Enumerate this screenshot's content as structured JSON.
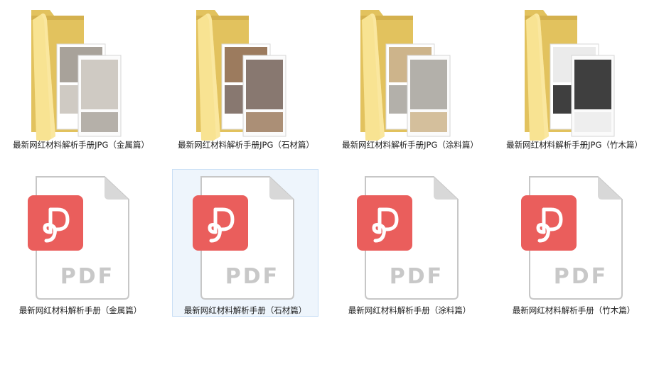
{
  "colors": {
    "folder_back": "#e2c25e",
    "folder_front": "#f8e392",
    "pdf_badge": "#ea5e5c",
    "pdf_text": "#c8c8c8",
    "selection_bg": "#eef5fc",
    "selection_border": "#c9dff5"
  },
  "folders": [
    {
      "name": "最新网红材料解析手册JPG（金属篇）",
      "icon": "folder-metal-photos-icon",
      "photo_a": "#a8a29a",
      "photo_b": "#cfcac3"
    },
    {
      "name": "最新网红材料解析手册JPG（石材篇）",
      "icon": "folder-stone-photos-icon",
      "photo_a": "#9c7b5e",
      "photo_b": "#887870"
    },
    {
      "name": "最新网红材料解析手册JPG（涂料篇）",
      "icon": "folder-paint-photos-icon",
      "photo_a": "#cdb48b",
      "photo_b": "#b3b0aa"
    },
    {
      "name": "最新网红材料解析手册JPG（竹木篇）",
      "icon": "folder-bamboo-wood-photos-icon",
      "photo_a": "#ebebeb",
      "photo_b": "#3f3f3f"
    }
  ],
  "pdfs": [
    {
      "name": "最新网红材料解析手册（金属篇）",
      "icon": "pdf-file-icon",
      "type_label": "PDF",
      "selected": false
    },
    {
      "name": "最新网红材料解析手册（石材篇）",
      "icon": "pdf-file-icon",
      "type_label": "PDF",
      "selected": true
    },
    {
      "name": "最新网红材料解析手册（涂料篇）",
      "icon": "pdf-file-icon",
      "type_label": "PDF",
      "selected": false
    },
    {
      "name": "最新网红材料解析手册（竹木篇）",
      "icon": "pdf-file-icon",
      "type_label": "PDF",
      "selected": false
    }
  ]
}
